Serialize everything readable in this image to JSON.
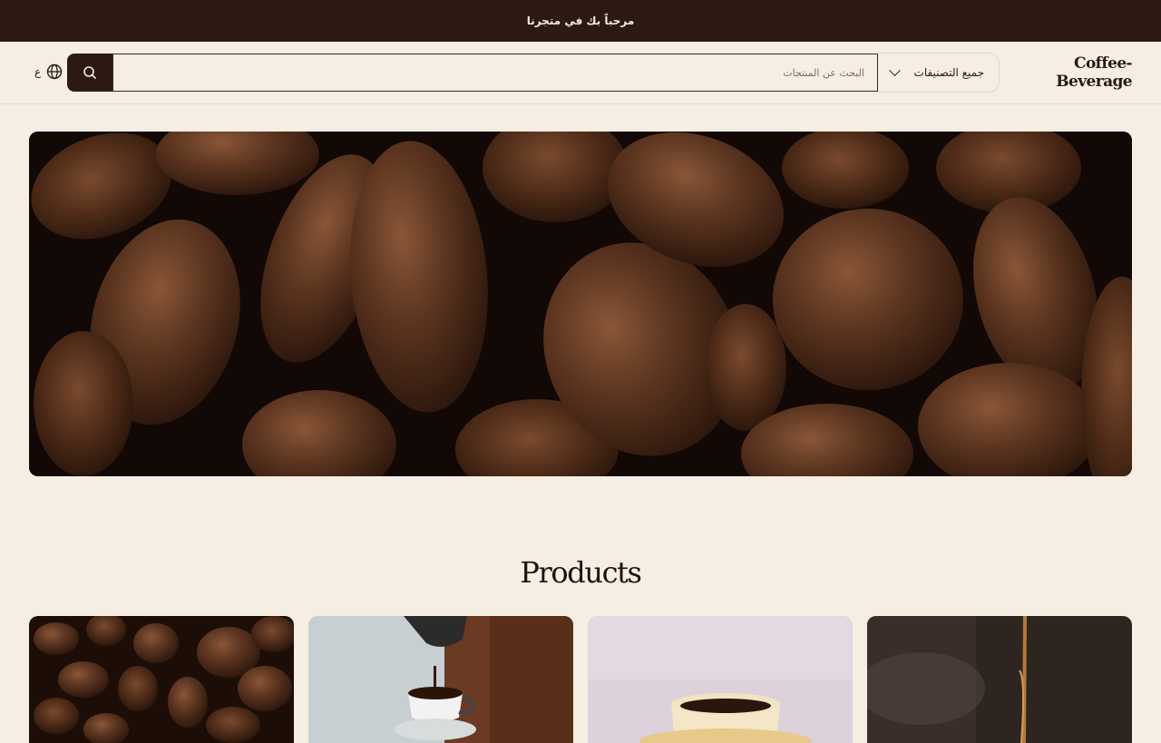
{
  "announcement": {
    "text": "مرحباً بك في متجرنا"
  },
  "header": {
    "logo": "Coffee-Beverage",
    "category_select": {
      "value": "جميع التصنيفات"
    },
    "search": {
      "placeholder": "البحث عن المنتجات"
    },
    "search_button_icon": "search-icon",
    "language": {
      "label": "ع",
      "icon": "globe-icon"
    }
  },
  "hero": {
    "image": "roasted coffee beans"
  },
  "products": {
    "title": "Products",
    "cards": [
      {
        "image": "coffee beans"
      },
      {
        "image": "espresso pouring into cup"
      },
      {
        "image": "cup of coffee"
      },
      {
        "image": "coffee pouring stream"
      }
    ]
  },
  "colors": {
    "background": "#f6ede3",
    "dark_brown": "#2c1a12"
  }
}
